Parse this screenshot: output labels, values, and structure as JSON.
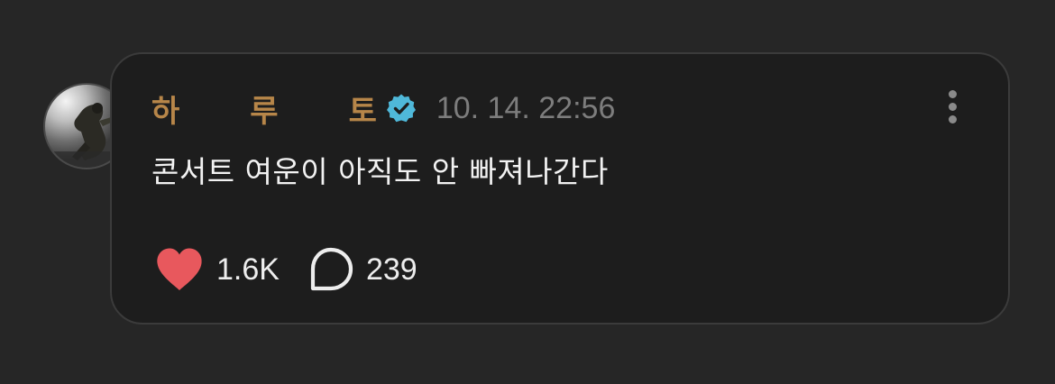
{
  "post": {
    "author": {
      "name_chars": [
        "하",
        "루",
        "토"
      ],
      "verified": true,
      "name_color": "#b78649",
      "verified_color": "#4fb8d9"
    },
    "timestamp": "10. 14. 22:56",
    "text": "콘서트 여운이 아직도 안 빠져나간다",
    "actions": {
      "likes": "1.6K",
      "comments": "239",
      "like_icon": "heart-icon",
      "comment_icon": "speech-bubble-icon",
      "like_color": "#e8585d"
    },
    "more_icon": "vertical-dots-icon"
  }
}
